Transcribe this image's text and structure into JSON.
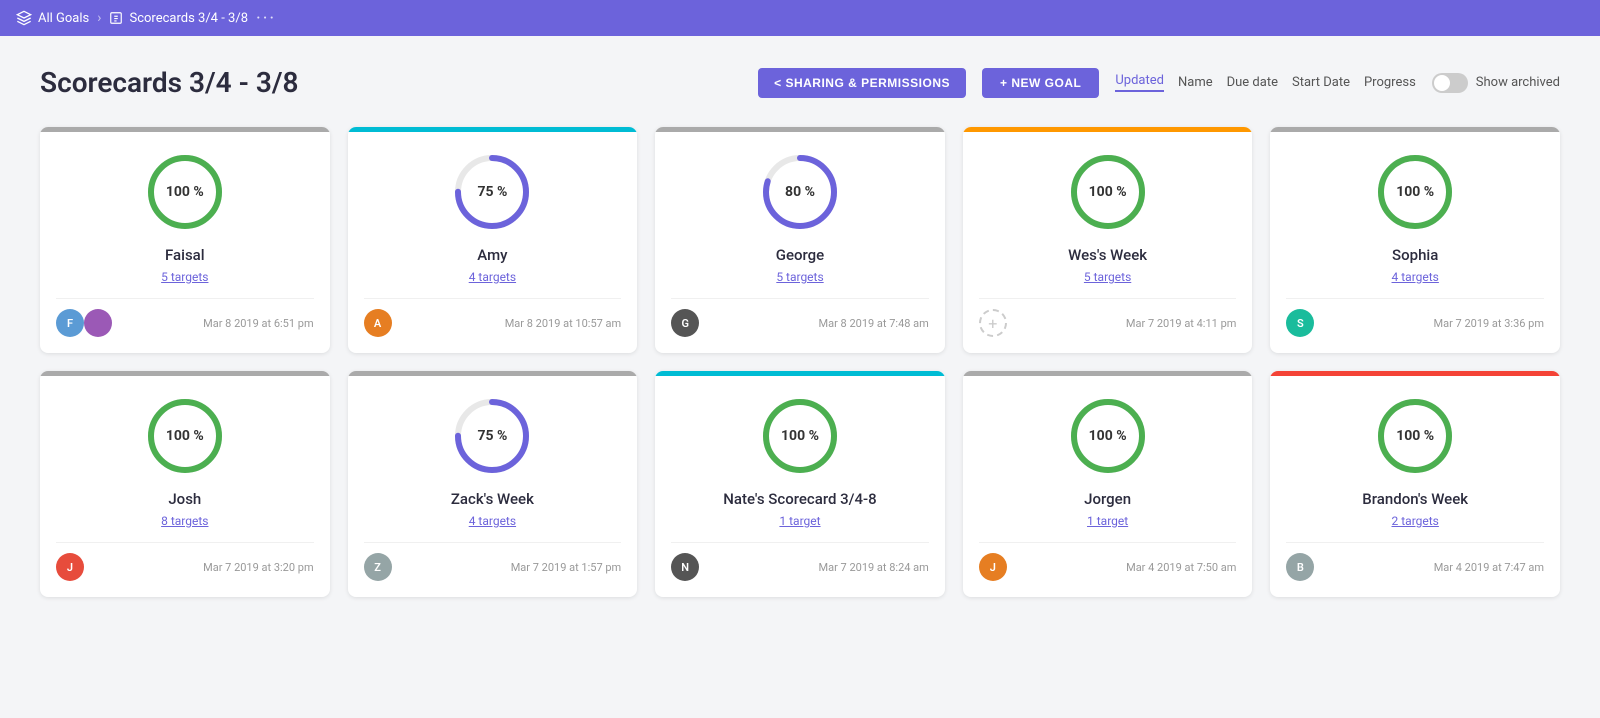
{
  "nav": {
    "all_goals": "All Goals",
    "current": "Scorecards 3/4 - 3/8",
    "dots": "···"
  },
  "header": {
    "title": "Scorecards 3/4 - 3/8",
    "sharing_btn": "< SHARING & PERMISSIONS",
    "new_goal_btn": "+ NEW GOAL",
    "sort_options": [
      "Updated",
      "Name",
      "Due date",
      "Start Date",
      "Progress"
    ],
    "active_sort": "Updated",
    "show_archived": "Show archived"
  },
  "cards": [
    {
      "id": 1,
      "name": "Faisal",
      "progress": 100,
      "targets": "5 targets",
      "date": "Mar 8 2019 at 6:51 pm",
      "bar_color": "#aaa",
      "circle_color": "#4caf50",
      "avatar_color": "av-blue",
      "avatar_initials": "F",
      "second_avatar": true,
      "second_avatar_color": "av-purple",
      "second_avatar_initials": "+"
    },
    {
      "id": 2,
      "name": "Amy",
      "progress": 75,
      "targets": "4 targets",
      "date": "Mar 8 2019 at 10:57 am",
      "bar_color": "#00bcd4",
      "circle_color": "#6c63db",
      "avatar_color": "av-orange",
      "avatar_initials": "A",
      "second_avatar": false
    },
    {
      "id": 3,
      "name": "George",
      "progress": 80,
      "targets": "5 targets",
      "date": "Mar 8 2019 at 7:48 am",
      "bar_color": "#aaa",
      "circle_color": "#6c63db",
      "avatar_color": "av-dark",
      "avatar_initials": "G",
      "second_avatar": false
    },
    {
      "id": 4,
      "name": "Wes's Week",
      "progress": 100,
      "targets": "5 targets",
      "date": "Mar 7 2019 at 4:11 pm",
      "bar_color": "#ff9800",
      "circle_color": "#4caf50",
      "avatar_add": true,
      "second_avatar": false
    },
    {
      "id": 5,
      "name": "Sophia",
      "progress": 100,
      "targets": "4 targets",
      "date": "Mar 7 2019 at 3:36 pm",
      "bar_color": "#aaa",
      "circle_color": "#4caf50",
      "avatar_color": "av-teal",
      "avatar_initials": "S",
      "second_avatar": false
    },
    {
      "id": 6,
      "name": "Josh",
      "progress": 100,
      "targets": "8 targets",
      "date": "Mar 7 2019 at 3:20 pm",
      "bar_color": "#aaa",
      "circle_color": "#4caf50",
      "avatar_color": "av-red",
      "avatar_initials": "J",
      "second_avatar": false
    },
    {
      "id": 7,
      "name": "Zack's Week",
      "progress": 75,
      "targets": "4 targets",
      "date": "Mar 7 2019 at 1:57 pm",
      "bar_color": "#aaa",
      "circle_color": "#6c63db",
      "avatar_color": "av-gray",
      "avatar_initials": "Z",
      "second_avatar": false
    },
    {
      "id": 8,
      "name": "Nate's Scorecard 3/4-8",
      "progress": 100,
      "targets": "1 target",
      "date": "Mar 7 2019 at 8:24 am",
      "bar_color": "#00bcd4",
      "circle_color": "#4caf50",
      "avatar_color": "av-dark",
      "avatar_initials": "N",
      "second_avatar": false
    },
    {
      "id": 9,
      "name": "Jorgen",
      "progress": 100,
      "targets": "1 target",
      "date": "Mar 4 2019 at 7:50 am",
      "bar_color": "#aaa",
      "circle_color": "#4caf50",
      "avatar_color": "av-orange",
      "avatar_initials": "J",
      "second_avatar": false
    },
    {
      "id": 10,
      "name": "Brandon's Week",
      "progress": 100,
      "targets": "2 targets",
      "date": "Mar 4 2019 at 7:47 am",
      "bar_color": "#f44336",
      "circle_color": "#4caf50",
      "avatar_color": "av-gray",
      "avatar_initials": "B",
      "second_avatar": false
    }
  ]
}
